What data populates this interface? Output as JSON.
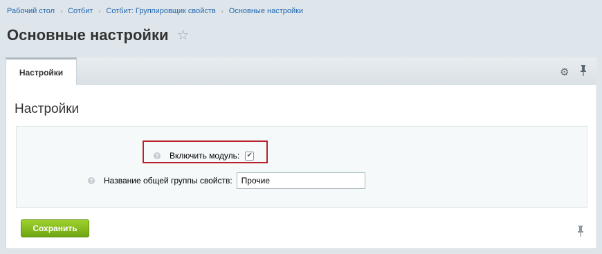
{
  "breadcrumb": {
    "items": [
      "Рабочий стол",
      "Сотбит",
      "Сотбит: Группировщик свойств",
      "Основные настройки"
    ],
    "separator": "›"
  },
  "page": {
    "title": "Основные настройки",
    "favorite_icon": "star-icon"
  },
  "tabs": [
    {
      "label": "Настройки",
      "active": true
    }
  ],
  "toolbar": {
    "icons": [
      "gear-icon",
      "pin-icon"
    ]
  },
  "section": {
    "title": "Настройки"
  },
  "form": {
    "enable_module": {
      "label": "Включить модуль:",
      "checked": true,
      "help_icon": "help-icon"
    },
    "group_name": {
      "label": "Название общей группы свойств:",
      "value": "Прочие",
      "help_icon": "help-icon"
    }
  },
  "actions": {
    "save_label": "Сохранить"
  },
  "colors": {
    "accent": "#2067b0",
    "save_button": "#7db61c",
    "highlight": "#b8202a"
  }
}
